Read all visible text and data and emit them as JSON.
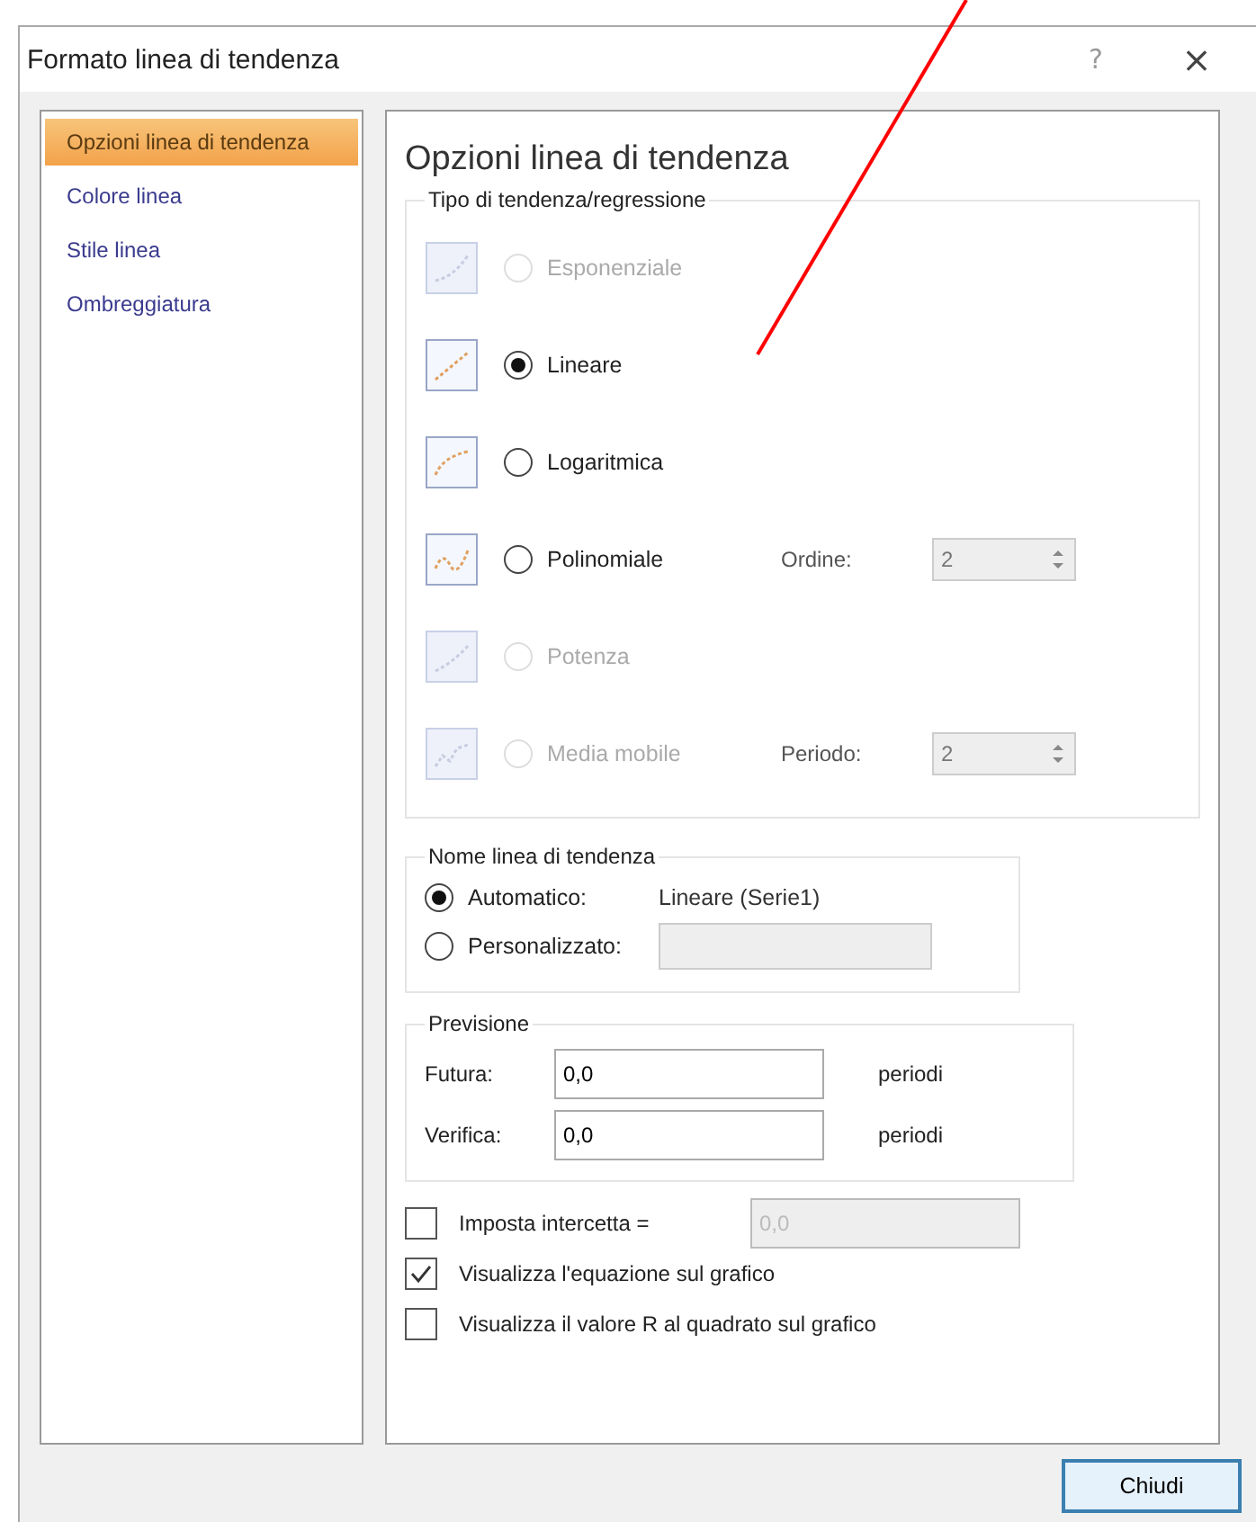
{
  "window": {
    "title": "Formato linea di tendenza",
    "help": "?",
    "close": "×"
  },
  "sidebar": {
    "items": [
      {
        "label": "Opzioni linea di tendenza",
        "selected": true
      },
      {
        "label": "Colore linea",
        "selected": false
      },
      {
        "label": "Stile linea",
        "selected": false
      },
      {
        "label": "Ombreggiatura",
        "selected": false
      }
    ]
  },
  "panel": {
    "title": "Opzioni linea di tendenza",
    "trend_type": {
      "title": "Tipo di tendenza/regressione",
      "options": [
        {
          "label": "Esponenziale",
          "selected": false,
          "disabled": true
        },
        {
          "label": "Lineare",
          "selected": true,
          "disabled": false
        },
        {
          "label": "Logaritmica",
          "selected": false,
          "disabled": false
        },
        {
          "label": "Polinomiale",
          "selected": false,
          "disabled": false,
          "param": {
            "label": "Ordine:",
            "value": "2"
          }
        },
        {
          "label": "Potenza",
          "selected": false,
          "disabled": true
        },
        {
          "label": "Media mobile",
          "selected": false,
          "disabled": true,
          "param": {
            "label": "Periodo:",
            "value": "2"
          }
        }
      ]
    },
    "name": {
      "title": "Nome linea di tendenza",
      "auto": {
        "label": "Automatico:",
        "value": "Lineare (Serie1)",
        "selected": true
      },
      "custom": {
        "label": "Personalizzato:",
        "selected": false
      }
    },
    "forecast": {
      "title": "Previsione",
      "rows": [
        {
          "label": "Futura:",
          "value": "0,0",
          "unit": "periodi"
        },
        {
          "label": "Verifica:",
          "value": "0,0",
          "unit": "periodi"
        }
      ]
    },
    "options": [
      {
        "label": "Imposta intercetta =",
        "checked": false,
        "value": "0,0"
      },
      {
        "label": "Visualizza l'equazione sul grafico",
        "checked": true
      },
      {
        "label": "Visualizza il valore R al quadrato sul grafico",
        "checked": false
      }
    ]
  },
  "buttons": [
    "Chiudi"
  ]
}
